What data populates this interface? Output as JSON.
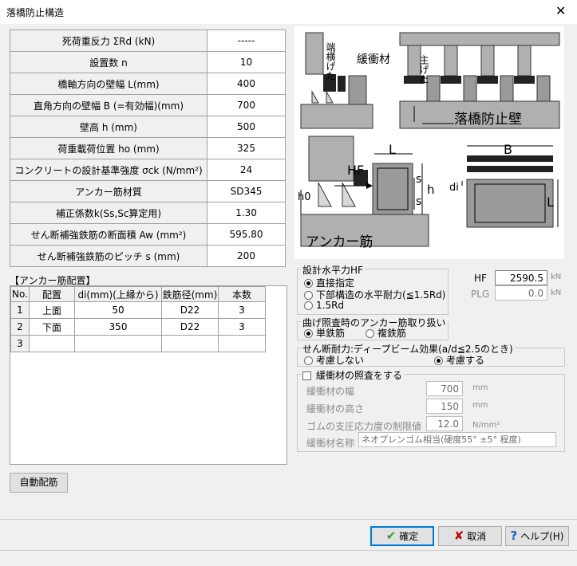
{
  "window": {
    "title": "落橋防止構造",
    "close_glyph": "✕"
  },
  "params": [
    {
      "label": "死荷重反力 ΣRd (kN)",
      "value": "-----"
    },
    {
      "label": "設置数 n",
      "value": "10"
    },
    {
      "label": "橋軸方向の壁幅 L(mm)",
      "value": "400"
    },
    {
      "label": "直角方向の壁幅 B (=有効幅)(mm)",
      "value": "700"
    },
    {
      "label": "壁高 h (mm)",
      "value": "500"
    },
    {
      "label": "荷重載荷位置 ho (mm)",
      "value": "325"
    },
    {
      "label": "コンクリートの設計基準強度 σck (N/mm²)",
      "value": "24"
    },
    {
      "label": "アンカー筋材質",
      "value": "SD345"
    },
    {
      "label": "補正係数k(Ss,Sc算定用)",
      "value": "1.30"
    },
    {
      "label": "せん断補強鉄筋の断面積 Aw (mm²)",
      "value": "595.80"
    },
    {
      "label": "せん断補強鉄筋のピッチ s (mm)",
      "value": "200"
    }
  ],
  "anchor": {
    "title": "【アンカー筋配置】",
    "headers": [
      "No.",
      "配置",
      "di(mm)(上縁から)",
      "鉄筋径(mm)",
      "本数"
    ],
    "rows": [
      [
        "1",
        "上面",
        "50",
        "D22",
        "3"
      ],
      [
        "2",
        "下面",
        "350",
        "D22",
        "3"
      ],
      [
        "3",
        "",
        "",
        "",
        ""
      ]
    ]
  },
  "diagram": {
    "labels": {
      "hashi": "端横げた",
      "kanshozai": "緩衝材",
      "shugeta": "主げた",
      "wall": "落橋防止壁",
      "L": "L",
      "B": "B",
      "HF": "HF",
      "s1": "s",
      "s2": "s",
      "h": "h",
      "h0": "h0",
      "di": "di",
      "L2": "L",
      "anchor": "アンカー筋"
    }
  },
  "hf_group": {
    "legend": "設計水平力HF",
    "options": [
      "直接指定",
      "下部構造の水平耐力(≦1.5Rd)",
      "1.5Rd"
    ],
    "selected": 0,
    "hf_label": "HF",
    "hf_value": "2590.5",
    "hf_unit": "kN",
    "plg_label": "PLG",
    "plg_value": "0.0",
    "plg_unit": "kN"
  },
  "bend_group": {
    "legend": "曲げ照査時のアンカー筋取り扱い",
    "options": [
      "単鉄筋",
      "複鉄筋"
    ],
    "selected": 0
  },
  "shear_group": {
    "legend": "せん断耐力:ディープビーム効果(a/d≦2.5のとき)",
    "options": [
      "考慮しない",
      "考慮する"
    ],
    "selected": 1
  },
  "cushion": {
    "legend": "緩衝材の照査をする",
    "width_label": "緩衝材の幅",
    "width_value": "700",
    "width_unit": "mm",
    "height_label": "緩衝材の高さ",
    "height_value": "150",
    "height_unit": "mm",
    "stress_label": "ゴムの支圧応力度の制限値",
    "stress_value": "12.0",
    "stress_unit": "N/mm²",
    "name_label": "緩衝材名称",
    "name_value": "ネオプレンゴム相当(硬度55° ±5° 程度)"
  },
  "buttons": {
    "auto": "自動配筋",
    "ok": "確定",
    "cancel": "取消",
    "help": "ヘルプ(H)"
  },
  "colors": {
    "ok_check": "#2e9e2e",
    "cancel_x": "#c00000",
    "help_q": "#1a5fd0"
  }
}
